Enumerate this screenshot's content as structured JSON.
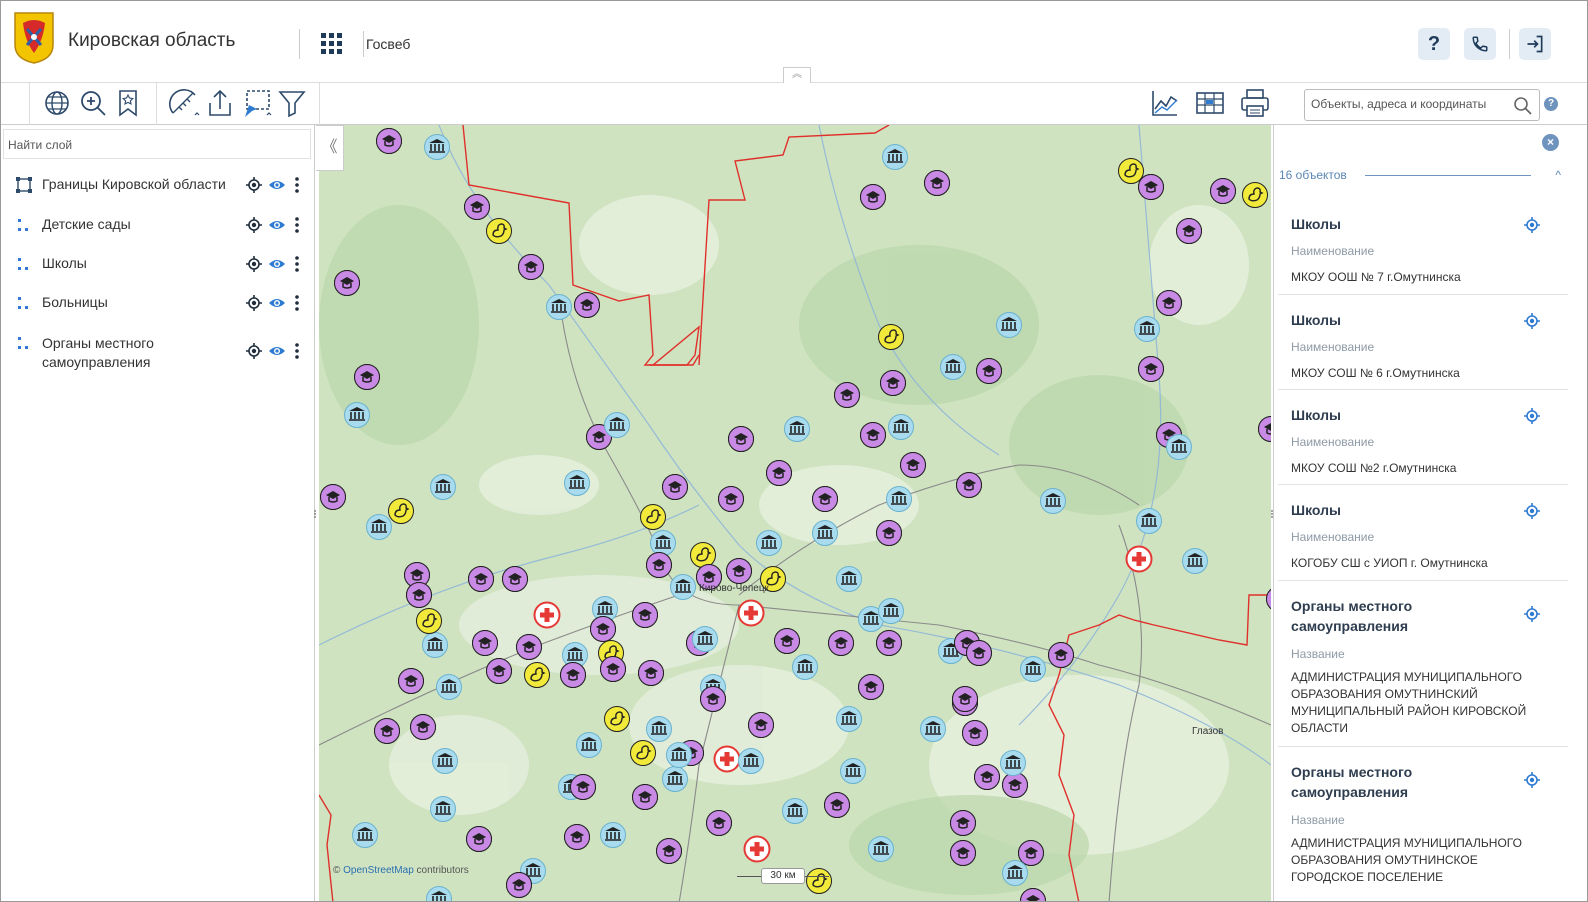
{
  "header": {
    "region_title": "Кировская область",
    "service_name": "Госвеб",
    "help_label": "?",
    "icons": [
      "coat-of-arms-icon",
      "apps-grid-icon",
      "help-icon",
      "phone-icon",
      "logout-icon"
    ]
  },
  "toolbar": {
    "tools": [
      "globe-icon",
      "zoom-icon",
      "bookmark-icon",
      "measure-icon",
      "share-icon",
      "select-icon",
      "filter-icon",
      "chart-icon",
      "table-icon",
      "print-icon"
    ],
    "search_placeholder": "Объекты, адреса и координаты",
    "help_label": "?"
  },
  "layers_panel": {
    "search_placeholder": "Найти слой",
    "layers": [
      {
        "label": "Границы Кировской области"
      },
      {
        "label": "Детские сады"
      },
      {
        "label": "Школы"
      },
      {
        "label": "Больницы"
      },
      {
        "label": "Органы местного самоуправления"
      }
    ]
  },
  "map": {
    "attribution_prefix": "©",
    "attribution_link": "OpenStreetMap",
    "attribution_suffix": "contributors",
    "scale_label": "30 км",
    "city_labels": [
      "Кирово-Чепецк",
      "Глазов"
    ],
    "marker_colors": {
      "school": "#c98ae6",
      "kindergarten": "#f2ea3a",
      "hospital": "#e53935",
      "government": "#a9dbee",
      "border": "#e0302b"
    }
  },
  "results_panel": {
    "close_label": "×",
    "count_label": "16 объектов",
    "collapse_label": "^",
    "cards": [
      {
        "title": "Школы",
        "field": "Наименование",
        "value": "МКОУ ООШ № 7 г.Омутнинска"
      },
      {
        "title": "Школы",
        "field": "Наименование",
        "value": "МКОУ СОШ № 6 г.Омутнинска"
      },
      {
        "title": "Школы",
        "field": "Наименование",
        "value": "МКОУ СОШ №2 г.Омутнинска"
      },
      {
        "title": "Школы",
        "field": "Наименование",
        "value": "КОГОБУ СШ с УИОП г. Омутнинска"
      },
      {
        "title": "Органы местного самоуправления",
        "field": "Название",
        "value": "АДМИНИСТРАЦИЯ МУНИЦИПАЛЬНОГО ОБРАЗОВАНИЯ ОМУТНИНСКИЙ МУНИЦИПАЛЬНЫЙ РАЙОН КИРОВСКОЙ ОБЛАСТИ"
      },
      {
        "title": "Органы местного самоуправления",
        "field": "Название",
        "value": "АДМИНИСТРАЦИЯ МУНИЦИПАЛЬНОГО ОБРАЗОВАНИЯ ОМУТНИНСКОЕ ГОРОДСКОЕ ПОСЕЛЕНИЕ"
      }
    ]
  }
}
